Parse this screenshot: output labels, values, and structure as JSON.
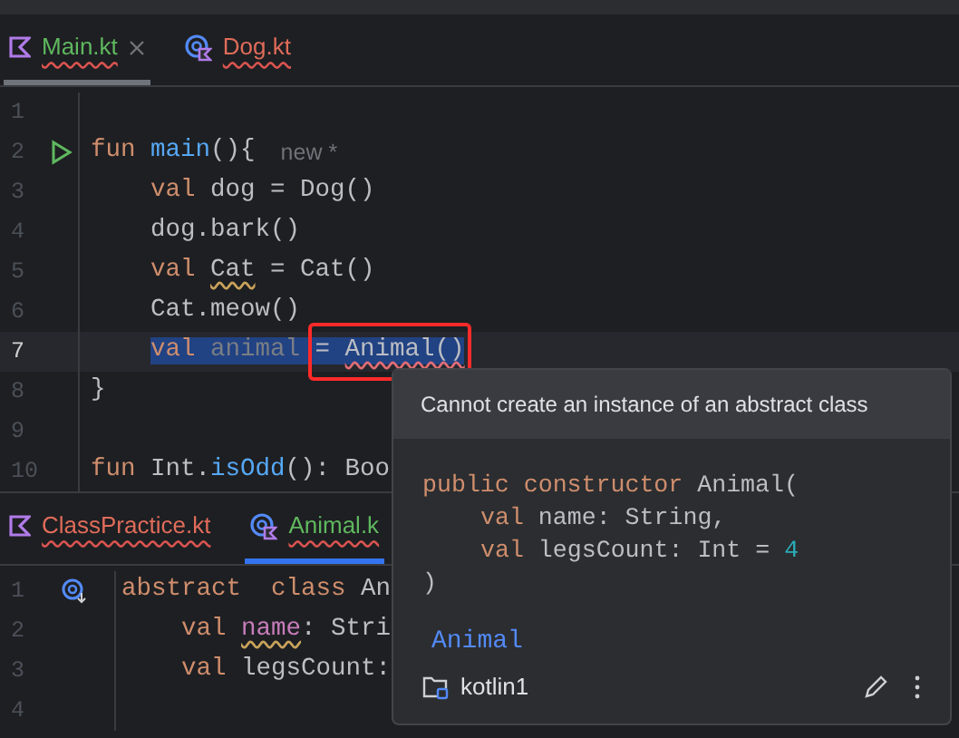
{
  "top_editor": {
    "tabs": [
      {
        "label": "Main.kt",
        "kind": "kotlin",
        "selected": true,
        "closable": true
      },
      {
        "label": "Dog.kt",
        "kind": "class",
        "selected": false,
        "closable": false
      }
    ],
    "lines": [
      {
        "number": "1"
      },
      {
        "number": "2",
        "run": true,
        "tokens": [
          {
            "t": "fun ",
            "kind": "kw"
          },
          {
            "t": "main",
            "kind": "fn"
          },
          {
            "t": "(){",
            "kind": "plain"
          },
          {
            "t": "new *",
            "kind": "hint"
          }
        ]
      },
      {
        "number": "3",
        "indented": true,
        "tokens": [
          {
            "t": "val ",
            "kind": "kw"
          },
          {
            "t": "dog = Dog()",
            "kind": "plain"
          }
        ]
      },
      {
        "number": "4",
        "indented": true,
        "tokens": [
          {
            "t": "dog.bark()",
            "kind": "plain"
          }
        ]
      },
      {
        "number": "5",
        "indented": true,
        "tokens": [
          {
            "t": "val ",
            "kind": "kw"
          },
          {
            "t": "Cat",
            "kind": "plain",
            "warning": true
          },
          {
            "t": " = Cat()",
            "kind": "plain"
          }
        ]
      },
      {
        "number": "6",
        "indented": true,
        "tokens": [
          {
            "t": "Cat.meow()",
            "kind": "plain"
          }
        ]
      },
      {
        "number": "7",
        "current": true,
        "indented": true,
        "tokens": [
          {
            "t": "val ",
            "kind": "kw",
            "selected": true
          },
          {
            "t": "animal ",
            "kind": "unused",
            "selected": true
          },
          {
            "t": "= ",
            "kind": "plain",
            "selected": true,
            "boxed": true
          },
          {
            "t": "Animal()",
            "kind": "plain",
            "selected": true,
            "error": true,
            "boxed": true
          }
        ]
      },
      {
        "number": "8",
        "tokens": [
          {
            "t": "}",
            "kind": "plain"
          }
        ]
      },
      {
        "number": "9"
      },
      {
        "number": "10",
        "tokens": [
          {
            "t": "fun ",
            "kind": "kw"
          },
          {
            "t": "Int.",
            "kind": "plain"
          },
          {
            "t": "isOdd",
            "kind": "fn"
          },
          {
            "t": "(): Boo",
            "kind": "plain"
          }
        ]
      }
    ]
  },
  "bottom_editor": {
    "tabs": [
      {
        "label": "ClassPractice.kt",
        "kind": "kotlin",
        "selected": false,
        "closable": false
      },
      {
        "label": "Animal.k",
        "kind": "class",
        "selected": true,
        "closable": false
      }
    ],
    "lines": [
      {
        "number": "1",
        "gutter_icon": true,
        "tokens": [
          {
            "t": "abstract  class ",
            "kind": "kw"
          },
          {
            "t": "An",
            "kind": "plain"
          }
        ]
      },
      {
        "number": "2",
        "indented": true,
        "tokens": [
          {
            "t": "val ",
            "kind": "kw"
          },
          {
            "t": "name",
            "kind": "prop",
            "warning": true
          },
          {
            "t": ": Stri",
            "kind": "plain"
          }
        ]
      },
      {
        "number": "3",
        "indented": true,
        "tokens": [
          {
            "t": "val ",
            "kind": "kw"
          },
          {
            "t": "legsCount:",
            "kind": "plain"
          }
        ]
      },
      {
        "number": "4"
      }
    ]
  },
  "popup": {
    "message": "Cannot create an instance of an abstract class",
    "signature": [
      {
        "tokens": [
          {
            "t": "public constructor ",
            "kind": "kw"
          },
          {
            "t": "Animal(",
            "kind": "plain"
          }
        ]
      },
      {
        "indented": true,
        "tokens": [
          {
            "t": "val ",
            "kind": "kw"
          },
          {
            "t": "name: String,",
            "kind": "plain"
          }
        ]
      },
      {
        "indented": true,
        "tokens": [
          {
            "t": "val ",
            "kind": "kw"
          },
          {
            "t": "legsCount: Int = ",
            "kind": "plain"
          },
          {
            "t": "4",
            "kind": "num"
          }
        ]
      },
      {
        "tokens": [
          {
            "t": ")",
            "kind": "plain"
          }
        ]
      }
    ],
    "link": "Animal",
    "module": "kotlin1"
  }
}
